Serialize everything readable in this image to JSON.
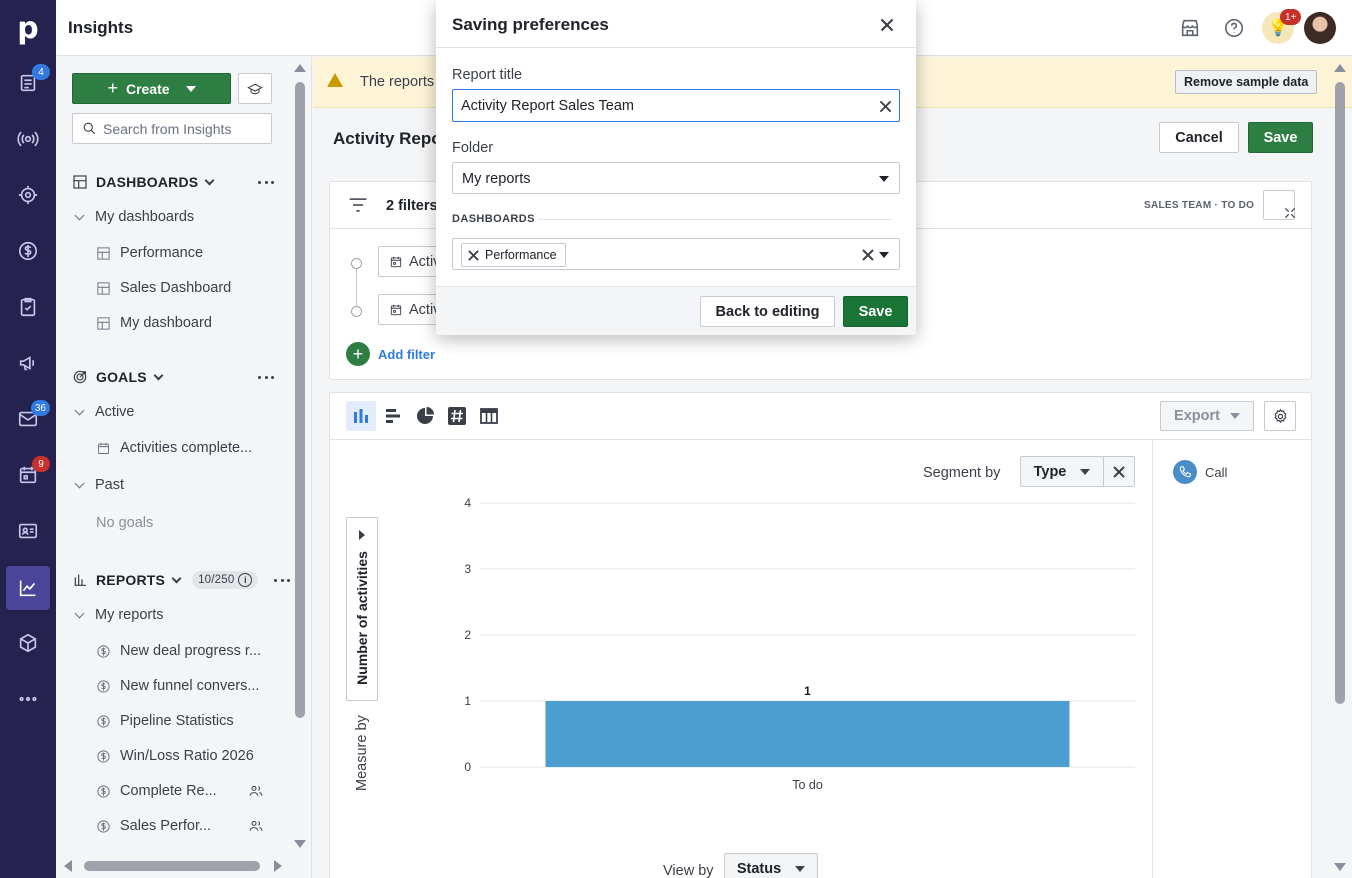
{
  "app": {
    "logo_letter": "p",
    "page_title": "Insights"
  },
  "rail": {
    "items": [
      {
        "name": "leads-inbox",
        "badge": "4"
      },
      {
        "name": "deals",
        "badge": ""
      },
      {
        "name": "leads",
        "badge": ""
      },
      {
        "name": "revenue",
        "badge": ""
      },
      {
        "name": "activities",
        "badge": ""
      },
      {
        "name": "campaigns",
        "badge": ""
      },
      {
        "name": "mail",
        "badge": "36"
      },
      {
        "name": "calendar",
        "badge": "9"
      },
      {
        "name": "contacts",
        "badge": ""
      },
      {
        "name": "insights",
        "badge": ""
      },
      {
        "name": "products",
        "badge": ""
      },
      {
        "name": "more",
        "badge": ""
      }
    ],
    "colors": {
      "background": "#26224f",
      "active": "#4a4599"
    }
  },
  "topbar": {
    "notifications_badge": "1+"
  },
  "sidebar": {
    "create_label": "Create",
    "search_placeholder": "Search from Insights",
    "dashboards": {
      "title": "DASHBOARDS",
      "group": "My dashboards",
      "items": [
        "Performance",
        "Sales Dashboard",
        "My dashboard"
      ]
    },
    "goals": {
      "title": "GOALS",
      "active_group": "Active",
      "active_items": [
        "Activities complete..."
      ],
      "past_group": "Past",
      "past_empty": "No goals"
    },
    "reports": {
      "title": "REPORTS",
      "count": "10/250",
      "group": "My reports",
      "items": [
        {
          "label": "New deal progress r...",
          "shared": false
        },
        {
          "label": "New funnel convers...",
          "shared": false
        },
        {
          "label": "Pipeline Statistics",
          "shared": false
        },
        {
          "label": "Win/Loss Ratio 2026",
          "shared": false
        },
        {
          "label": "Complete Re...",
          "shared": true
        },
        {
          "label": "Sales Perfor...",
          "shared": true
        }
      ]
    }
  },
  "main": {
    "warning_text": "The reports",
    "remove_sample_label": "Remove sample data",
    "report_name": "Activity Repo",
    "cancel_label": "Cancel",
    "save_label": "Save",
    "filters": {
      "title": "2 filters",
      "tags": "SALES TEAM  ·  TO DO",
      "chips": [
        "Activi",
        "Activi"
      ],
      "add_label": "Add filter"
    },
    "export_label": "Export",
    "segment_label": "Segment by",
    "segment_value": "Type",
    "measure_value": "Number of activities",
    "measure_label": "Measure by",
    "view_label": "View by",
    "view_value": "Status",
    "legend": [
      {
        "label": "Call",
        "color": "#4a8ec9"
      }
    ]
  },
  "chart_data": {
    "type": "bar",
    "categories": [
      "To do"
    ],
    "series": [
      {
        "values": [
          1
        ],
        "color": "#4c9ed1"
      }
    ],
    "ylim": [
      0,
      4
    ],
    "yticks": [
      0,
      1,
      2,
      3,
      4
    ],
    "data_labels": [
      "1"
    ],
    "grid": true,
    "ylabel": "Number of activities",
    "xlabel": ""
  },
  "modal": {
    "title": "Saving preferences",
    "report_title_label": "Report title",
    "report_title_value": "Activity Report Sales Team",
    "folder_label": "Folder",
    "folder_value": "My reports",
    "dashboards_label": "DASHBOARDS",
    "dashboard_tags": [
      "Performance"
    ],
    "back_label": "Back to editing",
    "save_label": "Save",
    "save_color": "#1a7436"
  }
}
